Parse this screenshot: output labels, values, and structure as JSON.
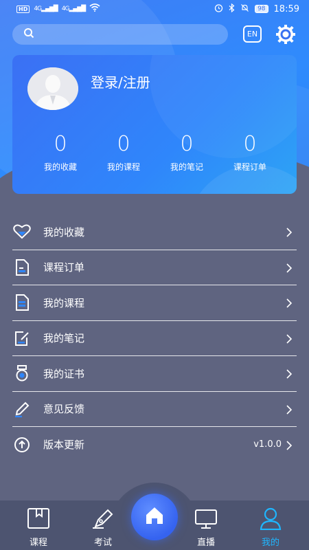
{
  "status_bar": {
    "chip": "HD",
    "signal1": "4G",
    "signal2": "4G",
    "battery": "98",
    "time": "18:59"
  },
  "topbar": {
    "search_placeholder": "",
    "language_button": "EN"
  },
  "profile": {
    "login_label": "登录/注册",
    "stats": [
      {
        "value": "0",
        "label": "我的收藏"
      },
      {
        "value": "0",
        "label": "我的课程"
      },
      {
        "value": "0",
        "label": "我的笔记"
      },
      {
        "value": "0",
        "label": "课程订单"
      }
    ]
  },
  "menu": {
    "items": [
      {
        "label": "我的收藏",
        "icon": "heart-icon"
      },
      {
        "label": "课程订单",
        "icon": "order-document-icon"
      },
      {
        "label": "我的课程",
        "icon": "course-document-icon"
      },
      {
        "label": "我的笔记",
        "icon": "note-edit-icon"
      },
      {
        "label": "我的证书",
        "icon": "certificate-medal-icon"
      },
      {
        "label": "意见反馈",
        "icon": "pencil-icon"
      },
      {
        "label": "版本更新",
        "icon": "upload-arrow-icon",
        "value": "v1.0.0"
      }
    ]
  },
  "tabbar": {
    "tabs": [
      {
        "label": "课程",
        "icon": "bookmark-book-icon"
      },
      {
        "label": "考试",
        "icon": "pen-exam-icon"
      },
      {
        "label": "",
        "icon": "home-icon"
      },
      {
        "label": "直播",
        "icon": "monitor-icon"
      },
      {
        "label": "我的",
        "icon": "user-icon"
      }
    ],
    "active_color": "#1fb6ff"
  },
  "colors": {
    "accent": "#2f86fb",
    "background": "#5f6480",
    "tabbar": "#4d5470"
  }
}
